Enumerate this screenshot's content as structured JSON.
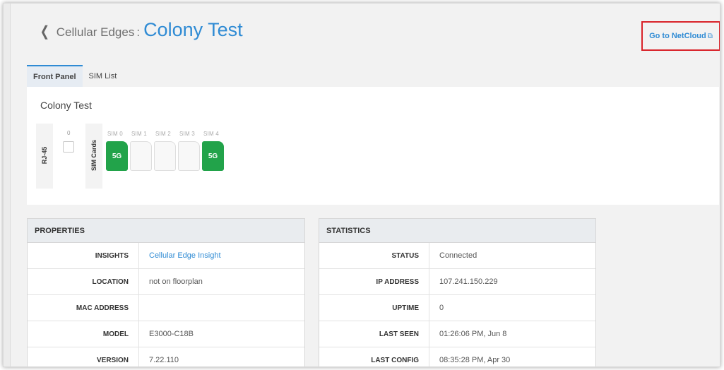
{
  "header": {
    "back_icon": "chevron-left-icon",
    "crumb": "Cellular Edges",
    "separator": ":",
    "title": "Colony Test",
    "netcloud_link": "Go to NetCloud",
    "external_icon": "⧉"
  },
  "tabs": [
    {
      "label": "Front Panel",
      "active": true
    },
    {
      "label": "SIM List",
      "active": false
    }
  ],
  "front_panel": {
    "title": "Colony Test",
    "rj45_label": "RJ-45",
    "port_number": "0",
    "sim_cards_label": "SIM Cards",
    "sims": [
      {
        "label": "SIM 0",
        "text": "5G",
        "active": true
      },
      {
        "label": "SIM 1",
        "text": "",
        "active": false
      },
      {
        "label": "SIM 2",
        "text": "",
        "active": false
      },
      {
        "label": "SIM 3",
        "text": "",
        "active": false
      },
      {
        "label": "SIM 4",
        "text": "5G",
        "active": true
      }
    ],
    "active_color": "#22a34a"
  },
  "properties": {
    "heading": "PROPERTIES",
    "rows": [
      {
        "key": "INSIGHTS",
        "value": "Cellular Edge Insight",
        "link": true
      },
      {
        "key": "LOCATION",
        "value": "not on floorplan",
        "link": false
      },
      {
        "key": "MAC ADDRESS",
        "value": "",
        "link": false
      },
      {
        "key": "MODEL",
        "value": "E3000-C18B",
        "link": false
      },
      {
        "key": "VERSION",
        "value": "7.22.110",
        "link": false
      }
    ]
  },
  "statistics": {
    "heading": "STATISTICS",
    "rows": [
      {
        "key": "STATUS",
        "value": "Connected"
      },
      {
        "key": "IP ADDRESS",
        "value": "107.241.150.229"
      },
      {
        "key": "UPTIME",
        "value": "0"
      },
      {
        "key": "LAST SEEN",
        "value": "01:26:06 PM, Jun 8"
      },
      {
        "key": "LAST CONFIG",
        "value": "08:35:28 PM, Apr 30"
      }
    ]
  },
  "colors": {
    "accent": "#2f8bd4",
    "highlight_border": "#d9232a"
  }
}
